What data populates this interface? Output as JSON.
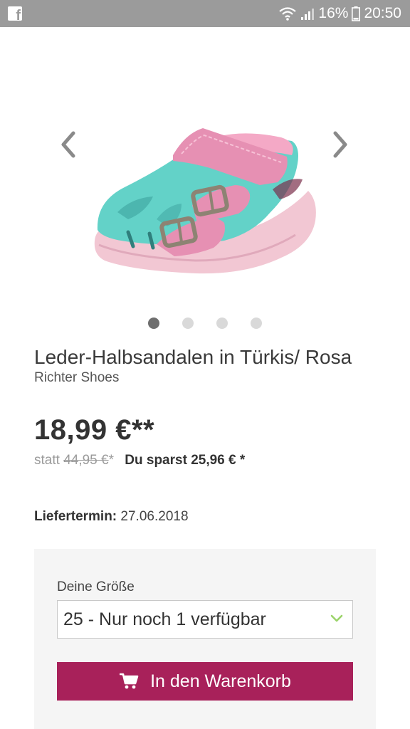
{
  "status_bar": {
    "battery_percent": "16%",
    "time": "20:50",
    "icons": [
      "facebook-icon",
      "wifi-icon",
      "signal-icon",
      "battery-icon"
    ]
  },
  "gallery": {
    "image_alt": "Leder-Halbsandalen in Türkis/ Rosa",
    "slide_count": 4,
    "active_slide": 1
  },
  "product": {
    "title": "Leder-Halbsandalen in Türkis/ Rosa",
    "brand": "Richter Shoes",
    "price": "18,99 €**",
    "old_price_prefix": "statt",
    "old_price": "44,95 €",
    "old_price_suffix": "*",
    "savings": "Du sparst 25,96 € *",
    "delivery_label": "Liefertermin:",
    "delivery_date": "27.06.2018"
  },
  "purchase": {
    "size_label": "Deine Größe",
    "size_value": "25 - Nur noch 1 verfügbar",
    "cart_button_label": "In den Warenkorb"
  },
  "colors": {
    "status_bar": "#9b9b9b",
    "cart_button": "#a8215a",
    "chevron_accent": "#9bd36a"
  }
}
